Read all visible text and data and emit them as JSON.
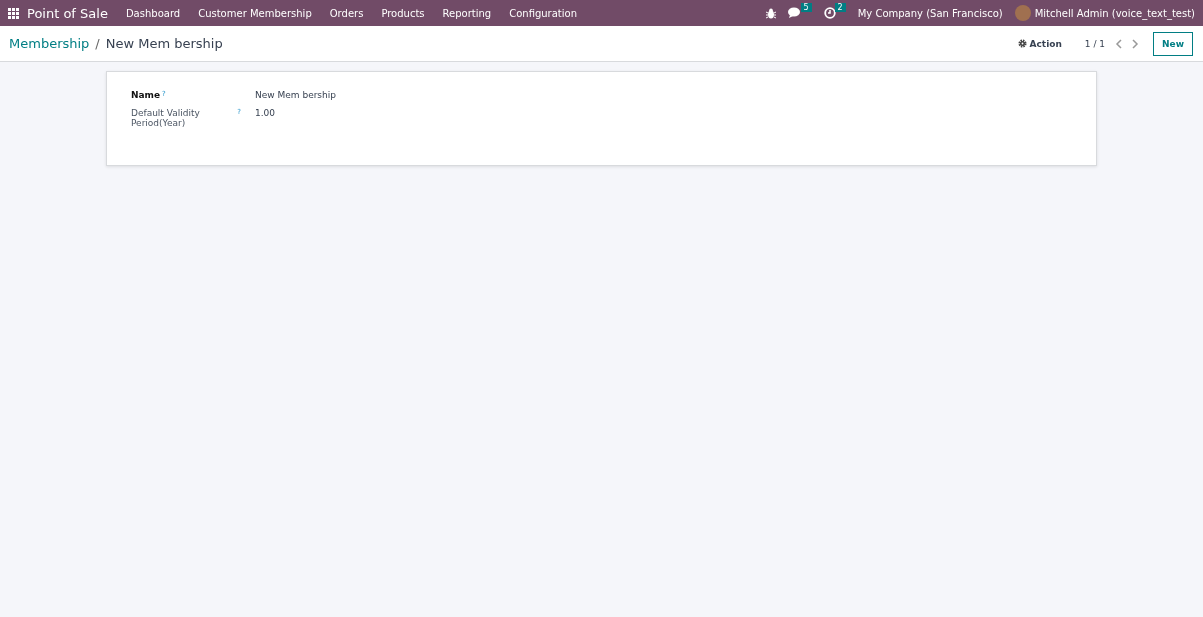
{
  "navbar": {
    "app_name": "Point of Sale",
    "menu": [
      "Dashboard",
      "Customer Membership",
      "Orders",
      "Products",
      "Reporting",
      "Configuration"
    ],
    "messages_count": "5",
    "activities_count": "2",
    "company": "My Company (San Francisco)",
    "user": "Mitchell Admin (voice_text_test)"
  },
  "control_panel": {
    "breadcrumb": "Membership",
    "separator": "/",
    "current": "New Mem bership",
    "action": "Action",
    "pager": "1 / 1",
    "new_button": "New"
  },
  "form": {
    "fields": [
      {
        "label": "Name",
        "help": "?",
        "value": "New Mem bership",
        "kind": "name"
      },
      {
        "label": "Default Validity Period(Year)",
        "help": "?",
        "value": "1.00",
        "kind": "number"
      }
    ]
  }
}
